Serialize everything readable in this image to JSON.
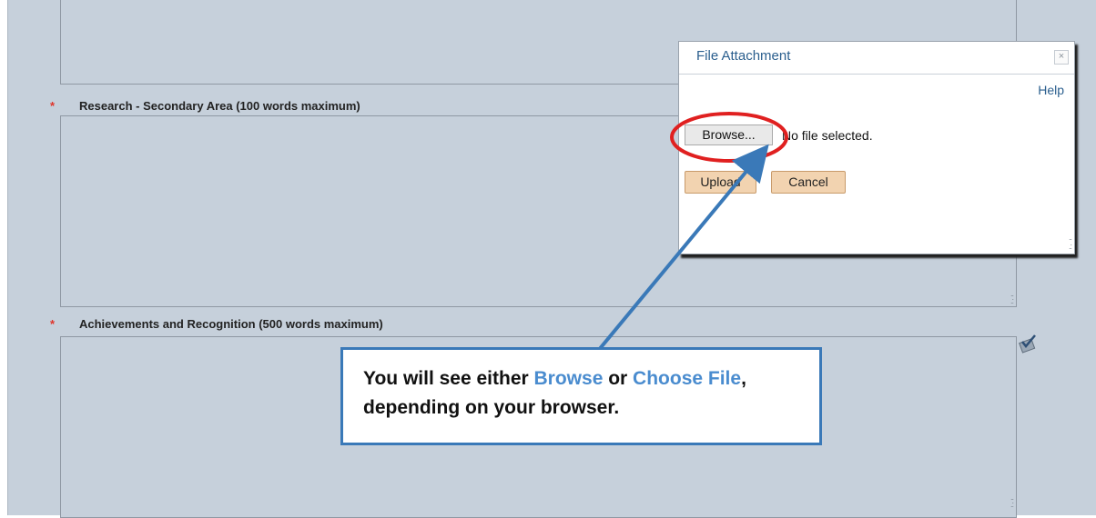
{
  "form": {
    "field_secondary": {
      "required_mark": "*",
      "label": "Research - Secondary Area (100 words maximum)"
    },
    "field_achievements": {
      "required_mark": "*",
      "label": "Achievements and Recognition (500 words maximum)"
    }
  },
  "modal": {
    "title": "File Attachment",
    "close_symbol": "×",
    "help_label": "Help",
    "browse_label": "Browse...",
    "no_file_text": "No file selected.",
    "upload_label": "Upload",
    "cancel_label": "Cancel"
  },
  "annotation": {
    "part1": "You will see either ",
    "browse": "Browse",
    "part2": " or ",
    "choose_file": "Choose File",
    "part3": ", depending on your browser."
  },
  "icons": {
    "resize_grip": "grip-icon",
    "spellcheck": "spellcheck-icon",
    "close": "close-icon"
  },
  "colors": {
    "page_bg": "#c6d0db",
    "accent_blue": "#3a79b8",
    "highlight_red": "#e02020",
    "button_peach": "#f2d3b0"
  }
}
